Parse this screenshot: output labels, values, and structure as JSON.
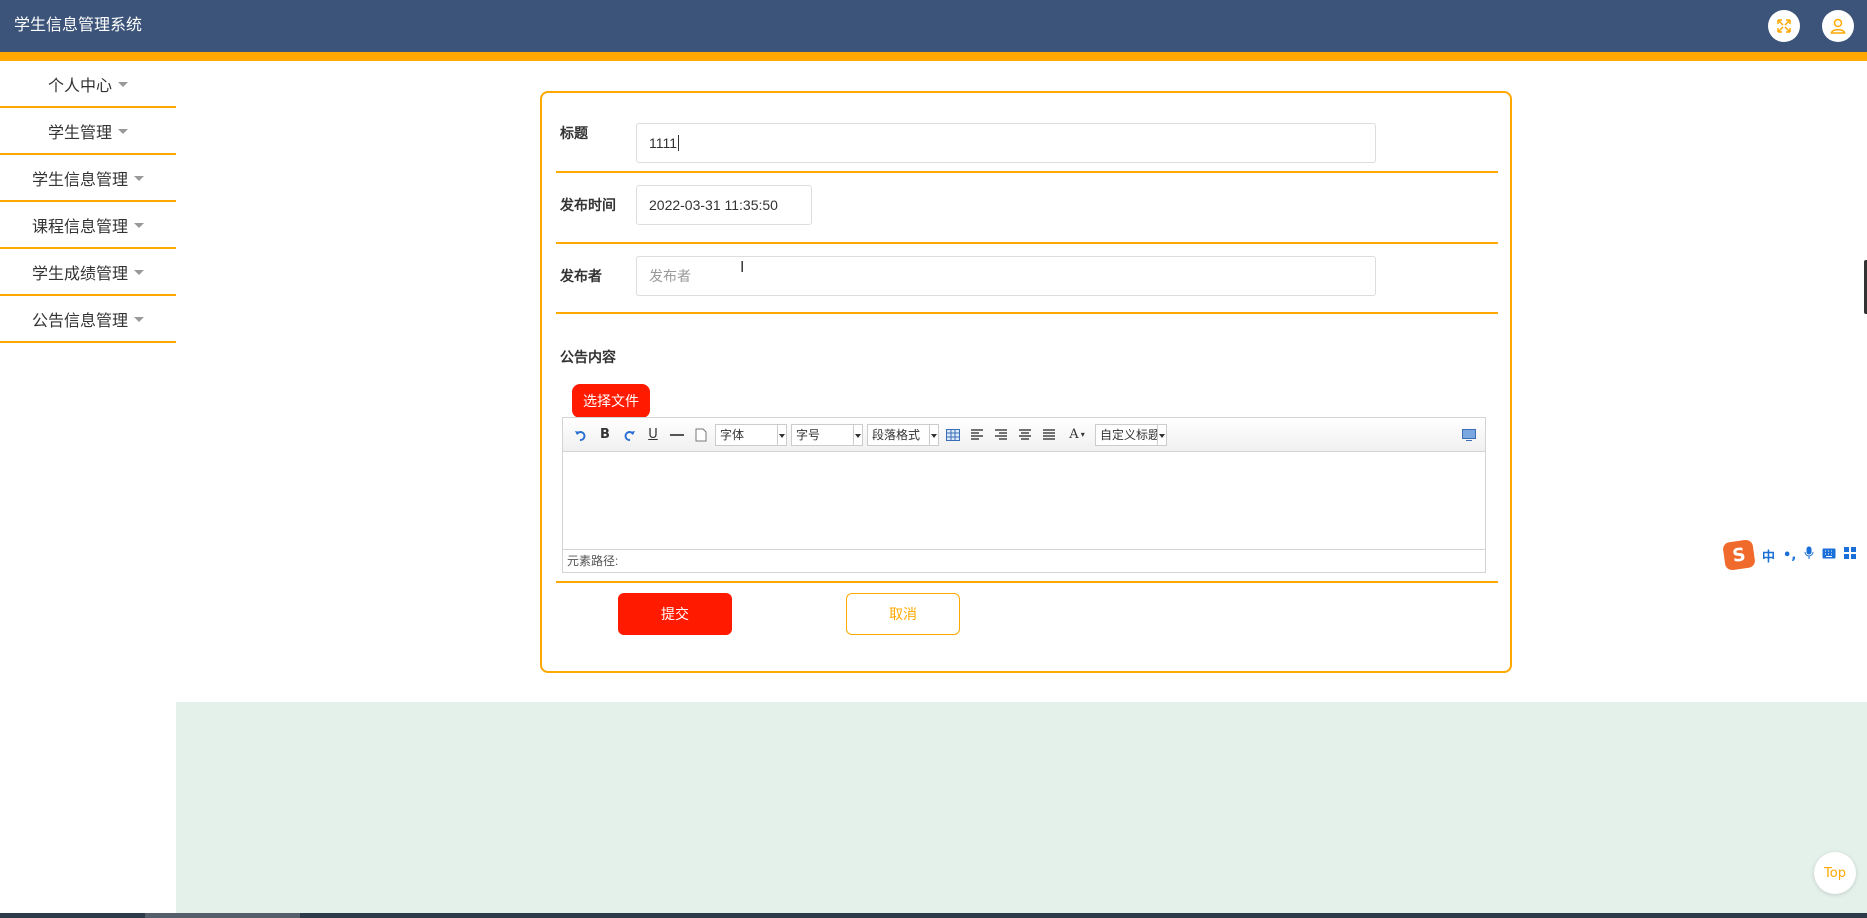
{
  "header": {
    "app_title": "学生信息管理系统",
    "fullscreen_icon": "fullscreen-icon",
    "user_icon": "user-icon",
    "accent_color": "#ffa800",
    "bar_color": "#3c5479"
  },
  "sidebar": {
    "items": [
      {
        "label": "个人中心"
      },
      {
        "label": "学生管理"
      },
      {
        "label": "学生信息管理"
      },
      {
        "label": "课程信息管理"
      },
      {
        "label": "学生成绩管理"
      },
      {
        "label": "公告信息管理"
      }
    ]
  },
  "form": {
    "title_label": "标题",
    "title_value": "1111",
    "time_label": "发布时间",
    "time_value": "2022-03-31 11:35:50",
    "publisher_label": "发布者",
    "publisher_placeholder": "发布者",
    "content_label": "公告内容",
    "choose_file_label": "选择文件",
    "editor": {
      "font_select": "字体",
      "size_select": "字号",
      "paragraph_select": "段落格式",
      "custom_title_select": "自定义标题",
      "bold_label": "B",
      "underline_label": "U",
      "font_color_label": "A",
      "status_text": "元素路径:"
    },
    "submit_label": "提交",
    "cancel_label": "取消"
  },
  "top_button_label": "Top",
  "ime": {
    "logo": "S",
    "mode": "中"
  }
}
